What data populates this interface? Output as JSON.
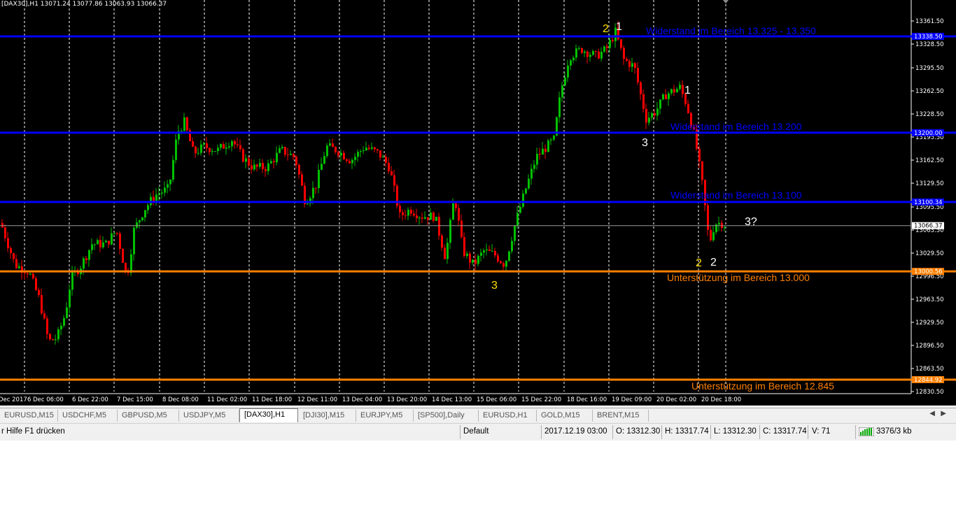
{
  "header": {
    "symbol_info": "[DAX30],H1  13071.24 13077.86 13063.93 13066.37"
  },
  "colors": {
    "bull": "#00c000",
    "bear": "#ff0000",
    "resistance": "#0000ff",
    "support": "#ff8000",
    "grid": "#ffffff",
    "annotation_yellow": "#ffe000"
  },
  "price_axis": {
    "ticks": [
      "13361.50",
      "13328.50",
      "13295.50",
      "13262.50",
      "13228.50",
      "13195.50",
      "13162.50",
      "13129.50",
      "13095.50",
      "13063.50",
      "13029.50",
      "12996.50",
      "12963.50",
      "12929.50",
      "12896.50",
      "12863.50",
      "12830.50"
    ],
    "line_tags": [
      "13338.50",
      "13200.00",
      "13100.34",
      "13066.37",
      "13000.56",
      "12844.92"
    ]
  },
  "time_axis": {
    "labels": [
      "Dec 2017",
      "6 Dec 06:00",
      "6 Dec 22:00",
      "7 Dec 15:00",
      "8 Dec 08:00",
      "11 Dec 02:00",
      "11 Dec 18:00",
      "12 Dec 11:00",
      "13 Dec 04:00",
      "13 Dec 20:00",
      "14 Dec 13:00",
      "15 Dec 06:00",
      "15 Dec 22:00",
      "18 Dec 16:00",
      "19 Dec 09:00",
      "20 Dec 02:00",
      "20 Dec 18:00"
    ]
  },
  "levels": [
    {
      "label": "Widerstand im Bereich 13.325 - 13.350",
      "price": 13338.5,
      "type": "resistance"
    },
    {
      "label": "Widerstand im Bereich 13.200",
      "price": 13200,
      "type": "resistance"
    },
    {
      "label": "Widerstand im Bereich 13.100",
      "price": 13100.34,
      "type": "resistance"
    },
    {
      "label": "Unterstützung im Bereich 13.000",
      "price": 13000.56,
      "type": "support"
    },
    {
      "label": "Unterstützung im Bereich 12.845",
      "price": 12844.92,
      "type": "support"
    }
  ],
  "wave_labels": [
    "1",
    "2",
    "1",
    "3",
    "2",
    "2",
    "3",
    "3?"
  ],
  "tabs": [
    "EURUSD,M15",
    "USDCHF,M5",
    "GBPUSD,M5",
    "USDJPY,M5",
    "[DAX30],H1",
    "[DJI30],M15",
    "EURJPY,M5",
    "[SP500],Daily",
    "EURUSD,H1",
    "GOLD,M15",
    "BRENT,M15"
  ],
  "active_tab": "[DAX30],H1",
  "status": {
    "help": "r Hilfe F1 drücken",
    "profile": "Default",
    "datetime": "2017.12.19 03:00",
    "open": "O: 13312.30",
    "high": "H: 13317.74",
    "low": "L: 13312.30",
    "close": "C: 13317.74",
    "volume": "V: 71",
    "traffic": "3376/3 kb"
  }
}
